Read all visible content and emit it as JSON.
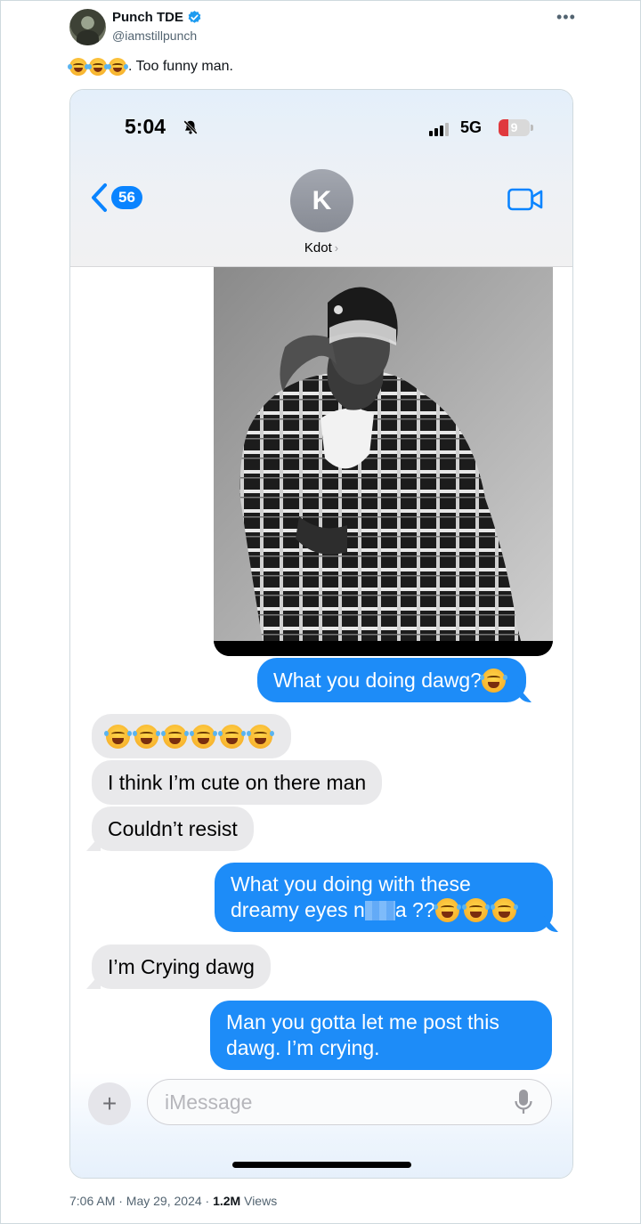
{
  "tweet": {
    "author_name": "Punch TDE",
    "author_handle": "@iamstillpunch",
    "more_label": "•••",
    "text": ". Too funny man.",
    "timestamp": "7:06 AM · May 29, 2024 · ",
    "views_count": "1.2M",
    "views_label": " Views"
  },
  "phone": {
    "status_time": "5:04",
    "network": "5G",
    "battery_level": "9",
    "back_count": "56",
    "contact_initial": "K",
    "contact_name": "Kdot",
    "input_placeholder": "iMessage",
    "plus_label": "+"
  },
  "messages": [
    {
      "dir": "out",
      "text": "What you doing dawg? "
    },
    {
      "dir": "in",
      "text": ""
    },
    {
      "dir": "in",
      "text": "I think I’m cute on there man"
    },
    {
      "dir": "in",
      "text": "Couldn’t resist"
    },
    {
      "dir": "out",
      "line1": "What you doing with these",
      "line2a": "dreamy eyes n",
      "line2b": "a ??"
    },
    {
      "dir": "in",
      "text": "I’m Crying dawg"
    },
    {
      "dir": "out",
      "line1": "Man you gotta let me post this",
      "line2": "dawg. I’m crying."
    }
  ],
  "colors": {
    "imessage_blue": "#1d8cf8",
    "incoming_gray": "#e9e9eb",
    "verified_blue": "#1d9bf0"
  }
}
